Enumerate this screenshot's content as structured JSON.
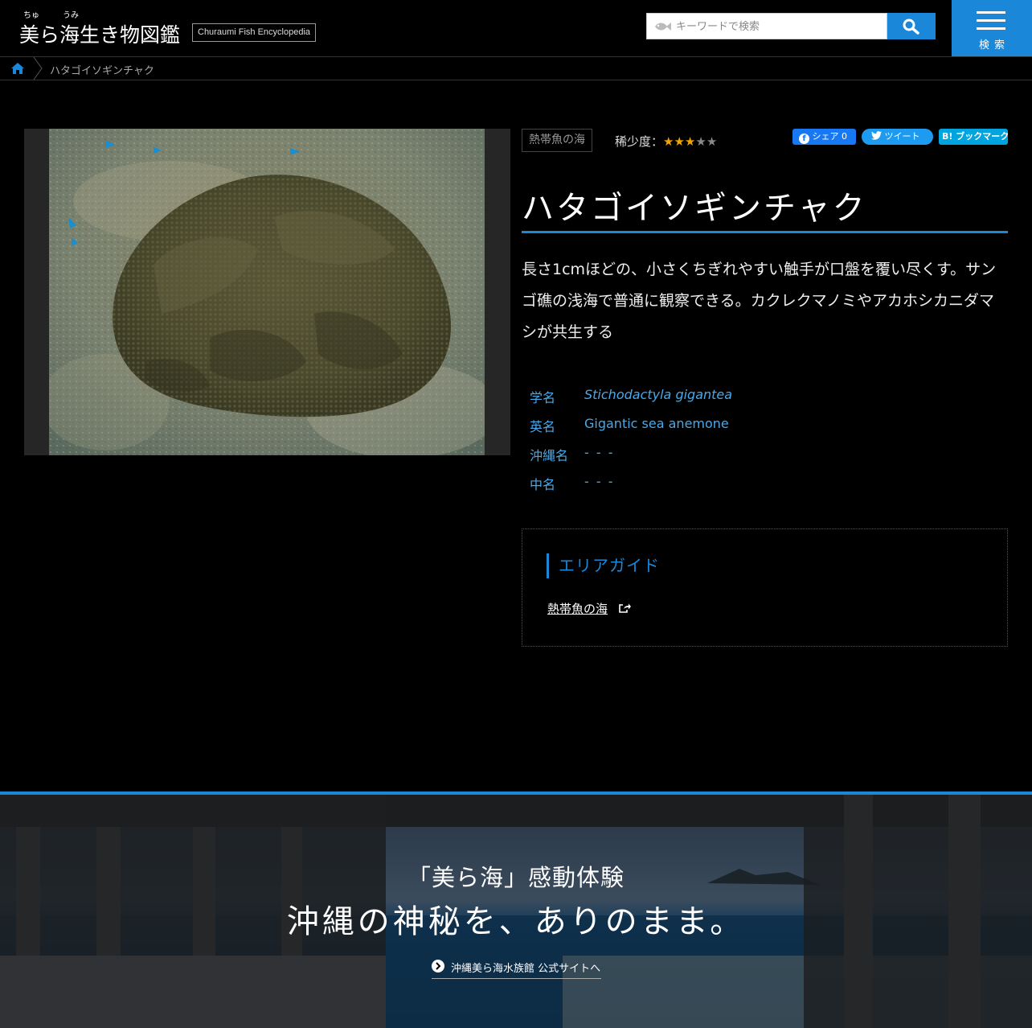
{
  "header": {
    "logo_ruby_1": "ちゅ",
    "logo_ruby_2": "うみ",
    "logo_title": "美ら海生き物図鑑",
    "logo_subtitle": "Churaumi Fish Encyclopedia",
    "search_placeholder": "キーワードで検索",
    "menu_label": "検索"
  },
  "breadcrumb": {
    "current": "ハタゴイソギンチャク"
  },
  "species": {
    "area_tag": "熱帯魚の海",
    "rarity_label": "稀少度：",
    "rarity_value": 3,
    "rarity_max": 5,
    "name": "ハタゴイソギンチャク",
    "description": "長さ1cmほどの、小さくちぎれやすい触手が口盤を覆い尽くす。サンゴ礁の浅海で普通に観察できる。カクレクマノミやアカホシカニダマシが共生する",
    "info": [
      {
        "key": "学名",
        "value": "Stichodactyla gigantea"
      },
      {
        "key": "英名",
        "value": "Gigantic sea anemone"
      },
      {
        "key": "沖縄名",
        "value": "- - -"
      },
      {
        "key": "中名",
        "value": "- - -"
      }
    ]
  },
  "sns": {
    "facebook": "シェア 0",
    "twitter": "ツイート",
    "hatena": "B! ブックマーク"
  },
  "area_guide": {
    "heading": "エリアガイド",
    "link": "熱帯魚の海"
  },
  "banner": {
    "line1": "「美ら海」感動体験",
    "line2": "沖縄の神秘を、ありのまま。",
    "link": "沖縄美ら海水族館 公式サイトへ"
  },
  "colors": {
    "accent": "#1a87d9",
    "star": "#f0a500",
    "background": "#000000"
  }
}
